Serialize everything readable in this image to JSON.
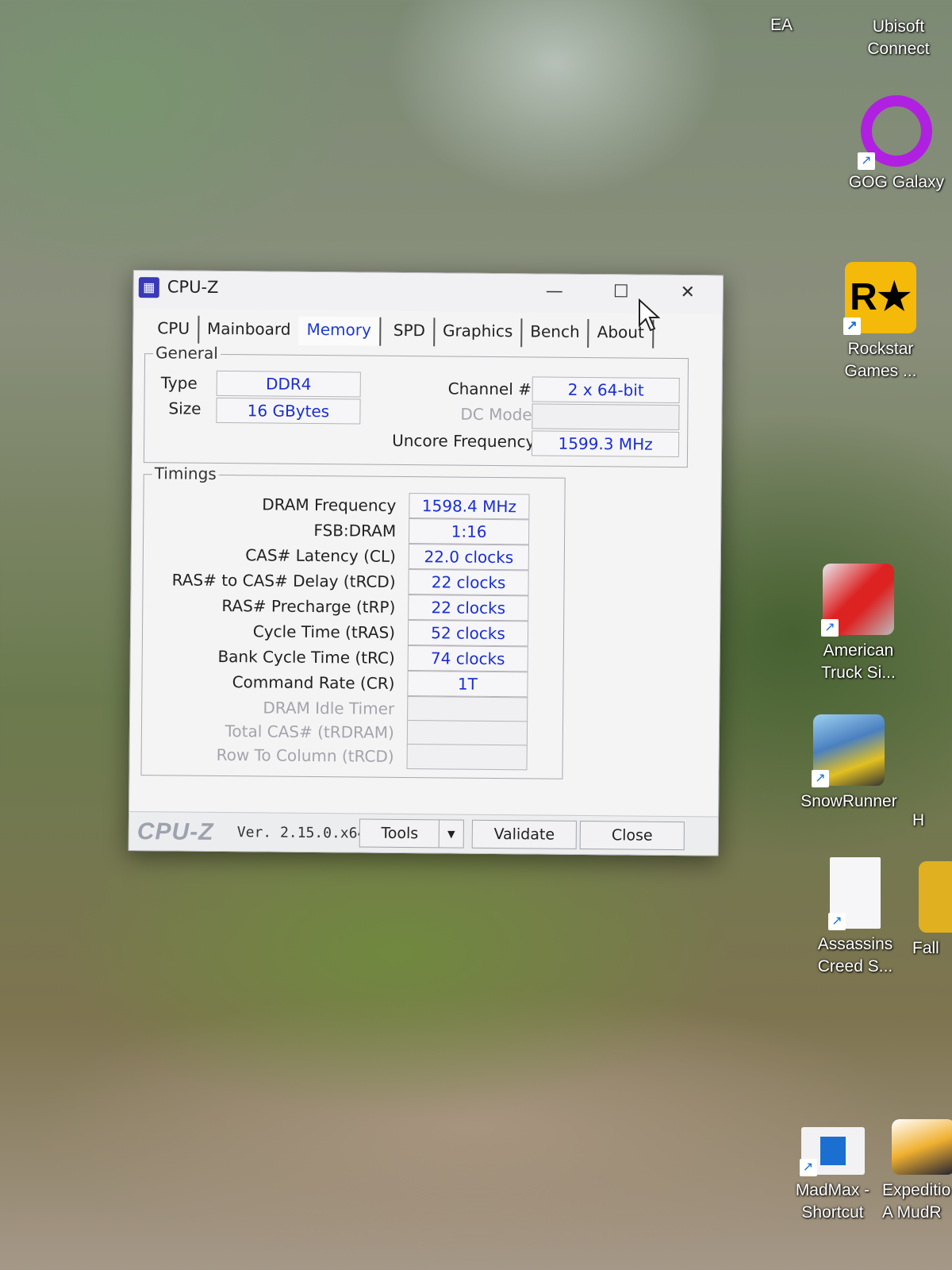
{
  "window": {
    "title": "CPU-Z",
    "tabs": [
      "CPU",
      "Mainboard",
      "Memory",
      "SPD",
      "Graphics",
      "Bench",
      "About"
    ],
    "active_tab": "Memory",
    "general": {
      "legend": "General",
      "type_label": "Type",
      "type_value": "DDR4",
      "size_label": "Size",
      "size_value": "16 GBytes",
      "channel_label": "Channel #",
      "channel_value": "2 x 64-bit",
      "dc_mode_label": "DC Mode",
      "dc_mode_value": "",
      "uncore_label": "Uncore Frequency",
      "uncore_value": "1599.3 MHz"
    },
    "timings": {
      "legend": "Timings",
      "rows": [
        {
          "label": "DRAM Frequency",
          "value": "1598.4 MHz"
        },
        {
          "label": "FSB:DRAM",
          "value": "1:16"
        },
        {
          "label": "CAS# Latency (CL)",
          "value": "22.0 clocks"
        },
        {
          "label": "RAS# to CAS# Delay (tRCD)",
          "value": "22 clocks"
        },
        {
          "label": "RAS# Precharge (tRP)",
          "value": "22 clocks"
        },
        {
          "label": "Cycle Time (tRAS)",
          "value": "52 clocks"
        },
        {
          "label": "Bank Cycle Time (tRC)",
          "value": "74 clocks"
        },
        {
          "label": "Command Rate (CR)",
          "value": "1T"
        },
        {
          "label": "DRAM Idle Timer",
          "value": ""
        },
        {
          "label": "Total CAS# (tRDRAM)",
          "value": ""
        },
        {
          "label": "Row To Column (tRCD)",
          "value": ""
        }
      ]
    },
    "footer": {
      "logo": "CPU-Z",
      "version": "Ver. 2.15.0.x64",
      "tools_label": "Tools",
      "validate_label": "Validate",
      "close_label": "Close"
    }
  },
  "desktop_icons": [
    {
      "label": "EA"
    },
    {
      "label": "Ubisoft Connect"
    },
    {
      "label": "GOG Galaxy"
    },
    {
      "label": "Rockstar Games ..."
    },
    {
      "label": "American Truck Si..."
    },
    {
      "label": "SnowRunner"
    },
    {
      "label": "Assassins Creed S..."
    },
    {
      "label": "MadMax - Shortcut"
    },
    {
      "label": "Expeditio A MudR"
    },
    {
      "label": "Fall"
    },
    {
      "label": "H"
    }
  ]
}
